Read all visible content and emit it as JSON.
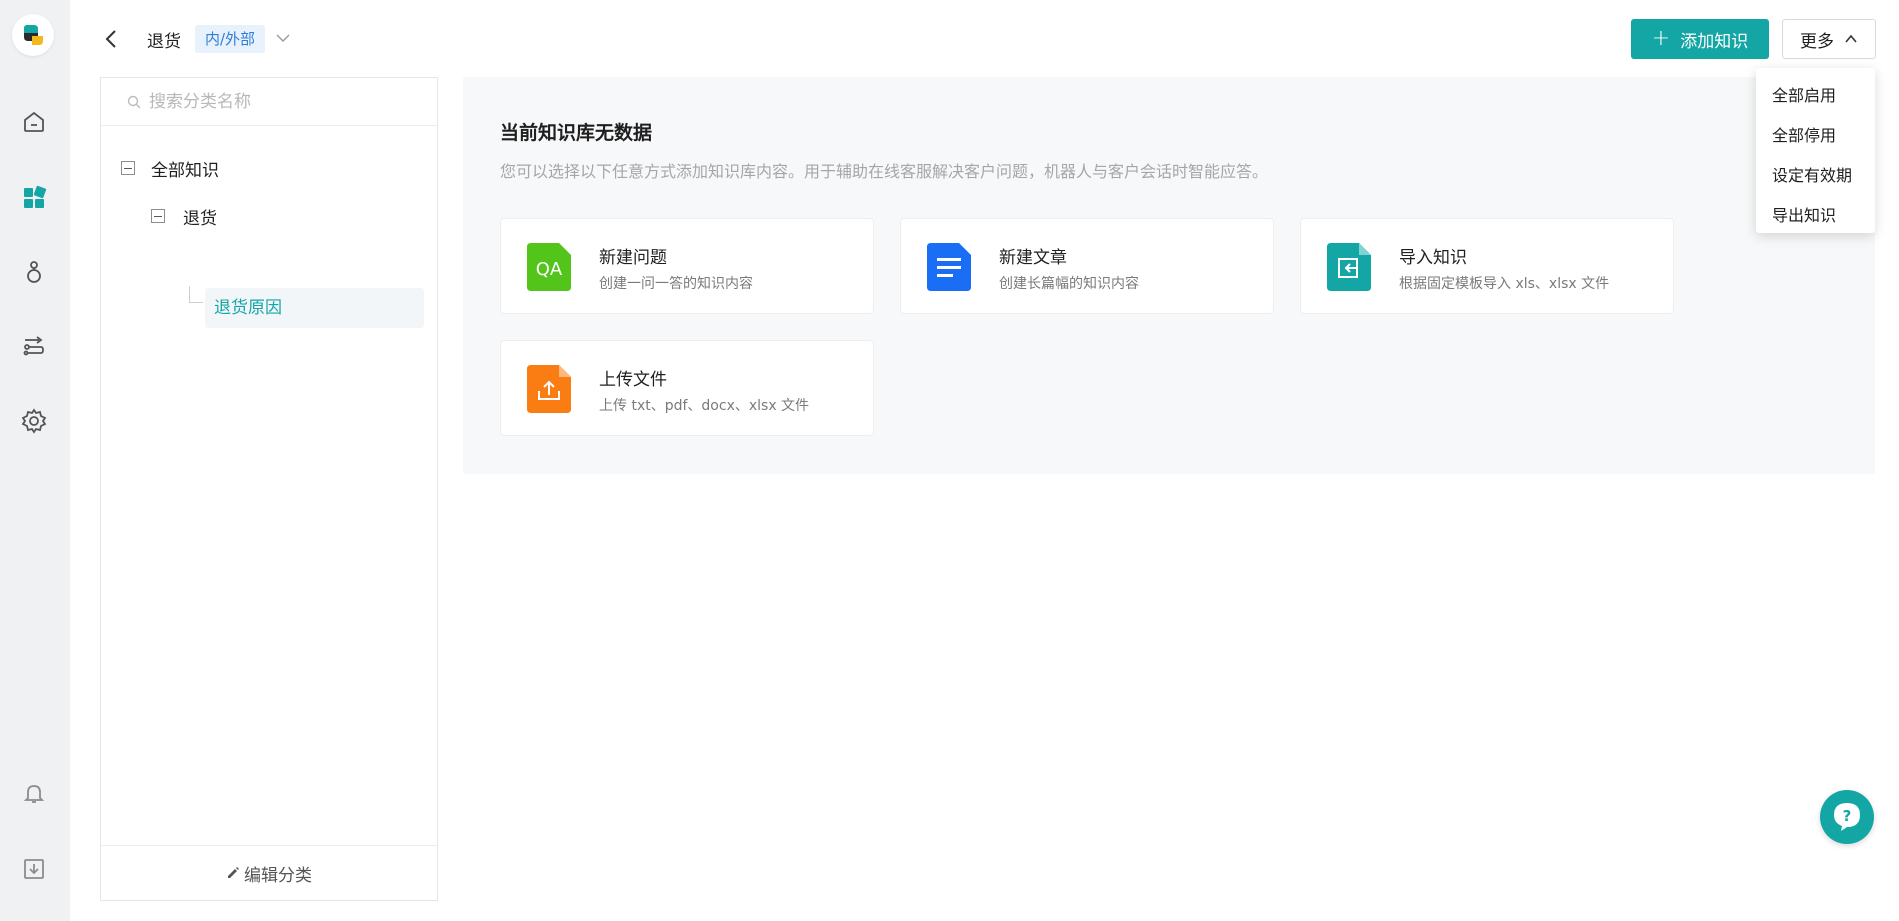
{
  "header": {
    "title": "退货",
    "tag": "内/外部",
    "add_button": "添加知识",
    "more_button": "更多"
  },
  "dropdown": {
    "items": [
      "全部启用",
      "全部停用",
      "设定有效期",
      "导出知识"
    ]
  },
  "sidebar": {
    "search_placeholder": "搜索分类名称",
    "tree": {
      "root": "全部知识",
      "child": "退货",
      "leaf": "退货原因"
    },
    "edit_label": "编辑分类"
  },
  "main": {
    "empty_title": "当前知识库无数据",
    "empty_desc": "您可以选择以下任意方式添加知识库内容。用于辅助在线客服解决客户问题，机器人与客户会话时智能应答。",
    "cards": [
      {
        "title": "新建问题",
        "subtitle": "创建一问一答的知识内容",
        "icon": "qa-icon",
        "icon_text": "QA"
      },
      {
        "title": "新建文章",
        "subtitle": "创建长篇幅的知识内容",
        "icon": "article-icon"
      },
      {
        "title": "导入知识",
        "subtitle": "根据固定模板导入 xls、xlsx 文件",
        "icon": "import-icon"
      },
      {
        "title": "上传文件",
        "subtitle": "上传 txt、pdf、docx、xlsx 文件",
        "icon": "upload-icon"
      }
    ]
  },
  "colors": {
    "accent": "#14a6a5",
    "qa_green": "#52c41a",
    "article_blue": "#1a6ef5",
    "import_teal": "#14a6a5",
    "upload_orange": "#fa7d14"
  },
  "rail": {
    "icons": [
      "logo-icon",
      "home-icon",
      "knowledge-icon",
      "robot-icon",
      "flow-icon",
      "settings-icon",
      "bell-icon",
      "download-icon"
    ]
  }
}
